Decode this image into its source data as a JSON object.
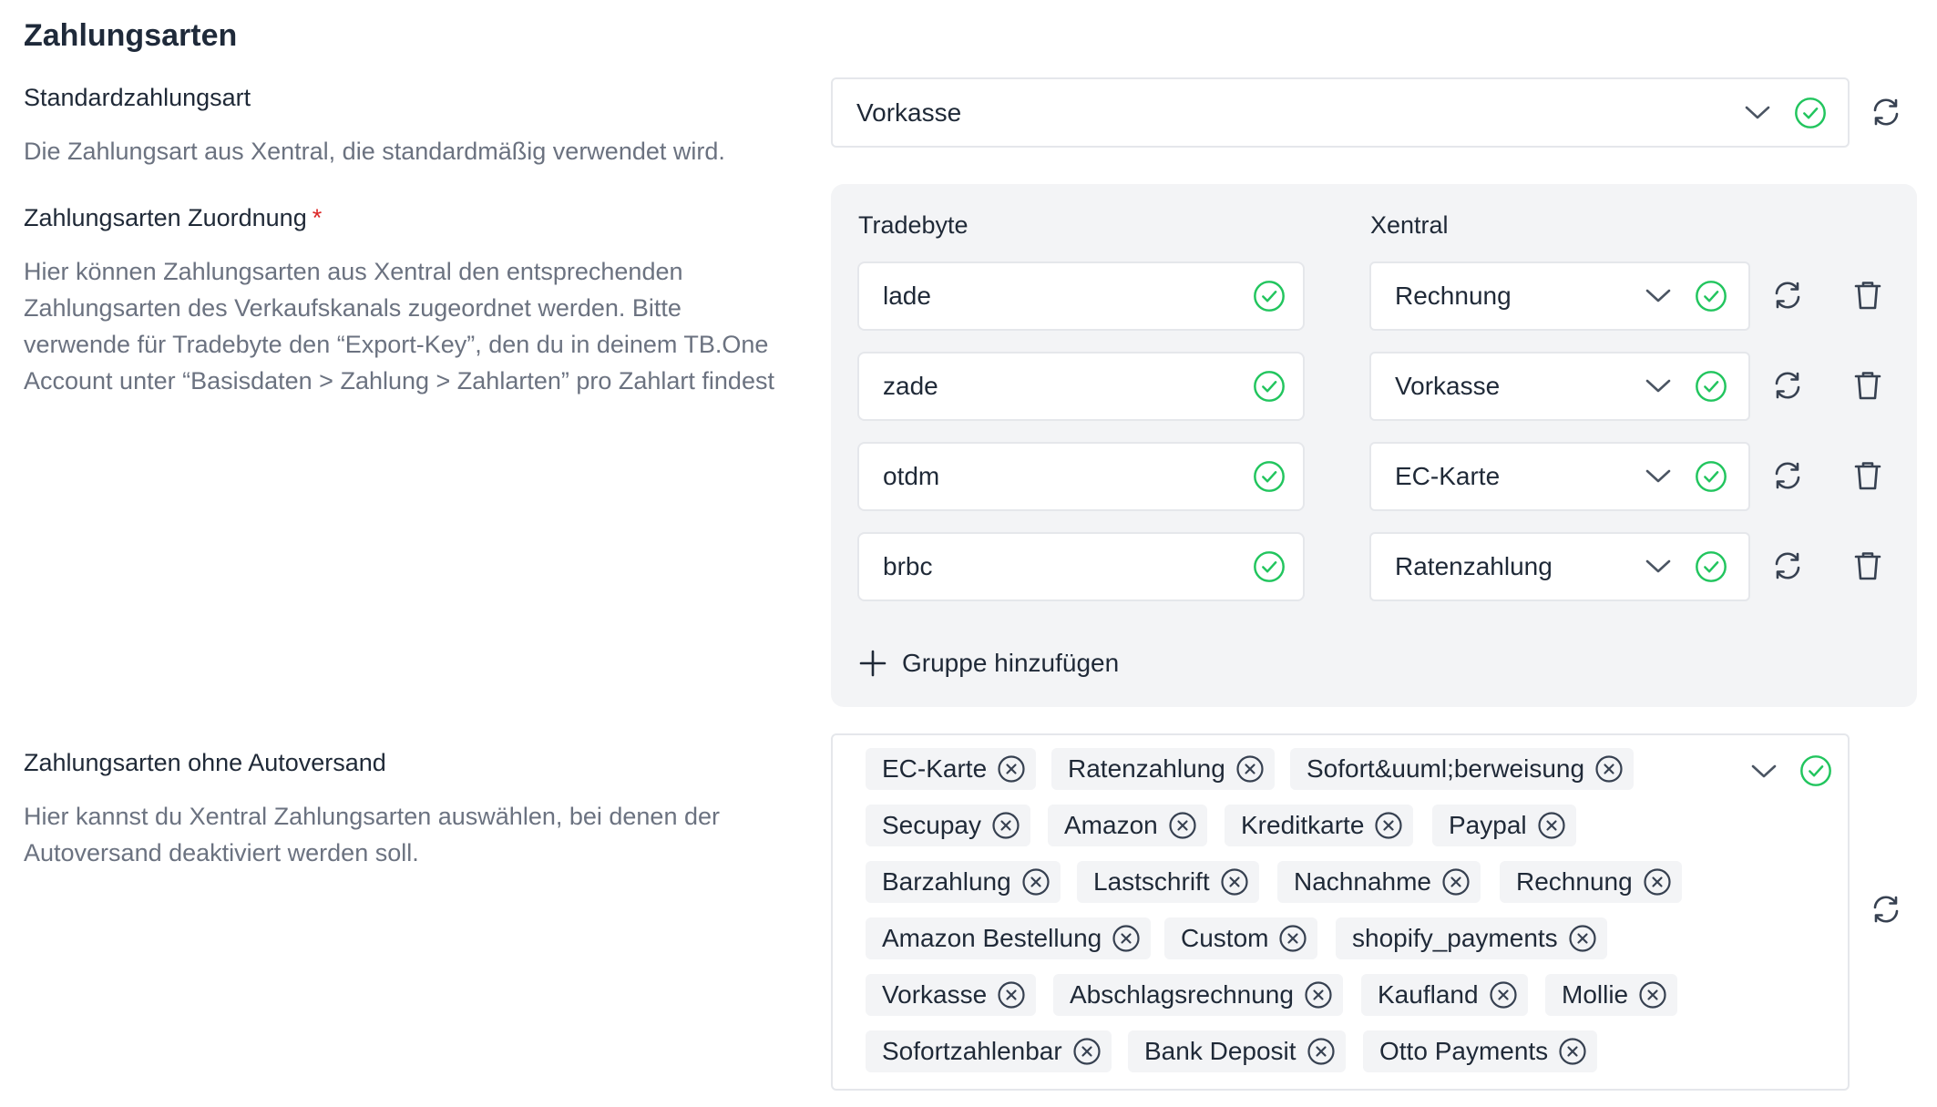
{
  "section": {
    "title": "Zahlungsarten"
  },
  "default_payment": {
    "label": "Standardzahlungsart",
    "help": "Die Zahlungsart aus Xentral, die standardmäßig verwendet wird.",
    "value": "Vorkasse"
  },
  "mapping": {
    "label": "Zahlungsarten Zuordnung",
    "required_mark": "*",
    "help": "Hier können Zahlungsarten aus Xentral den entsprechenden Zahlungsarten des Verkaufskanals zugeordnet werden. Bitte verwende für Tradebyte den “Export-Key”, den du in deinem TB.One Account unter “Basisdaten > Zahlung > Zahlarten” pro Zahlart findest",
    "col_left": "Tradebyte",
    "col_right": "Xentral",
    "rows": [
      {
        "tradebyte": "lade",
        "xentral": "Rechnung"
      },
      {
        "tradebyte": "zade",
        "xentral": "Vorkasse"
      },
      {
        "tradebyte": "otdm",
        "xentral": "EC-Karte"
      },
      {
        "tradebyte": "brbc",
        "xentral": "Ratenzahlung"
      }
    ],
    "add_group_label": "Gruppe hinzufügen"
  },
  "no_autoship": {
    "label": "Zahlungsarten ohne Autoversand",
    "help": "Hier kannst du Xentral Zahlungsarten auswählen, bei denen der Autoversand deaktiviert werden soll.",
    "tags": [
      "EC-Karte",
      "Ratenzahlung",
      "Sofort&uuml;berweisung",
      "Secupay",
      "Amazon",
      "Kreditkarte",
      "Paypal",
      "Barzahlung",
      "Lastschrift",
      "Nachnahme",
      "Rechnung",
      "Amazon Bestellung",
      "Custom",
      "shopify_payments",
      "Vorkasse",
      "Abschlagsrechnung",
      "Kaufland",
      "Mollie",
      "Sofortzahlenbar",
      "Bank Deposit",
      "Otto Payments"
    ]
  },
  "colors": {
    "success": "#22c55e",
    "icon": "#374151",
    "required": "#dc2626",
    "panel_bg": "#f3f4f6"
  },
  "icons": {
    "dropdown": "chevron-down-icon",
    "valid": "check-circle-icon",
    "refresh": "refresh-icon",
    "delete": "trash-icon",
    "add": "plus-icon",
    "remove": "x-circle-icon"
  }
}
